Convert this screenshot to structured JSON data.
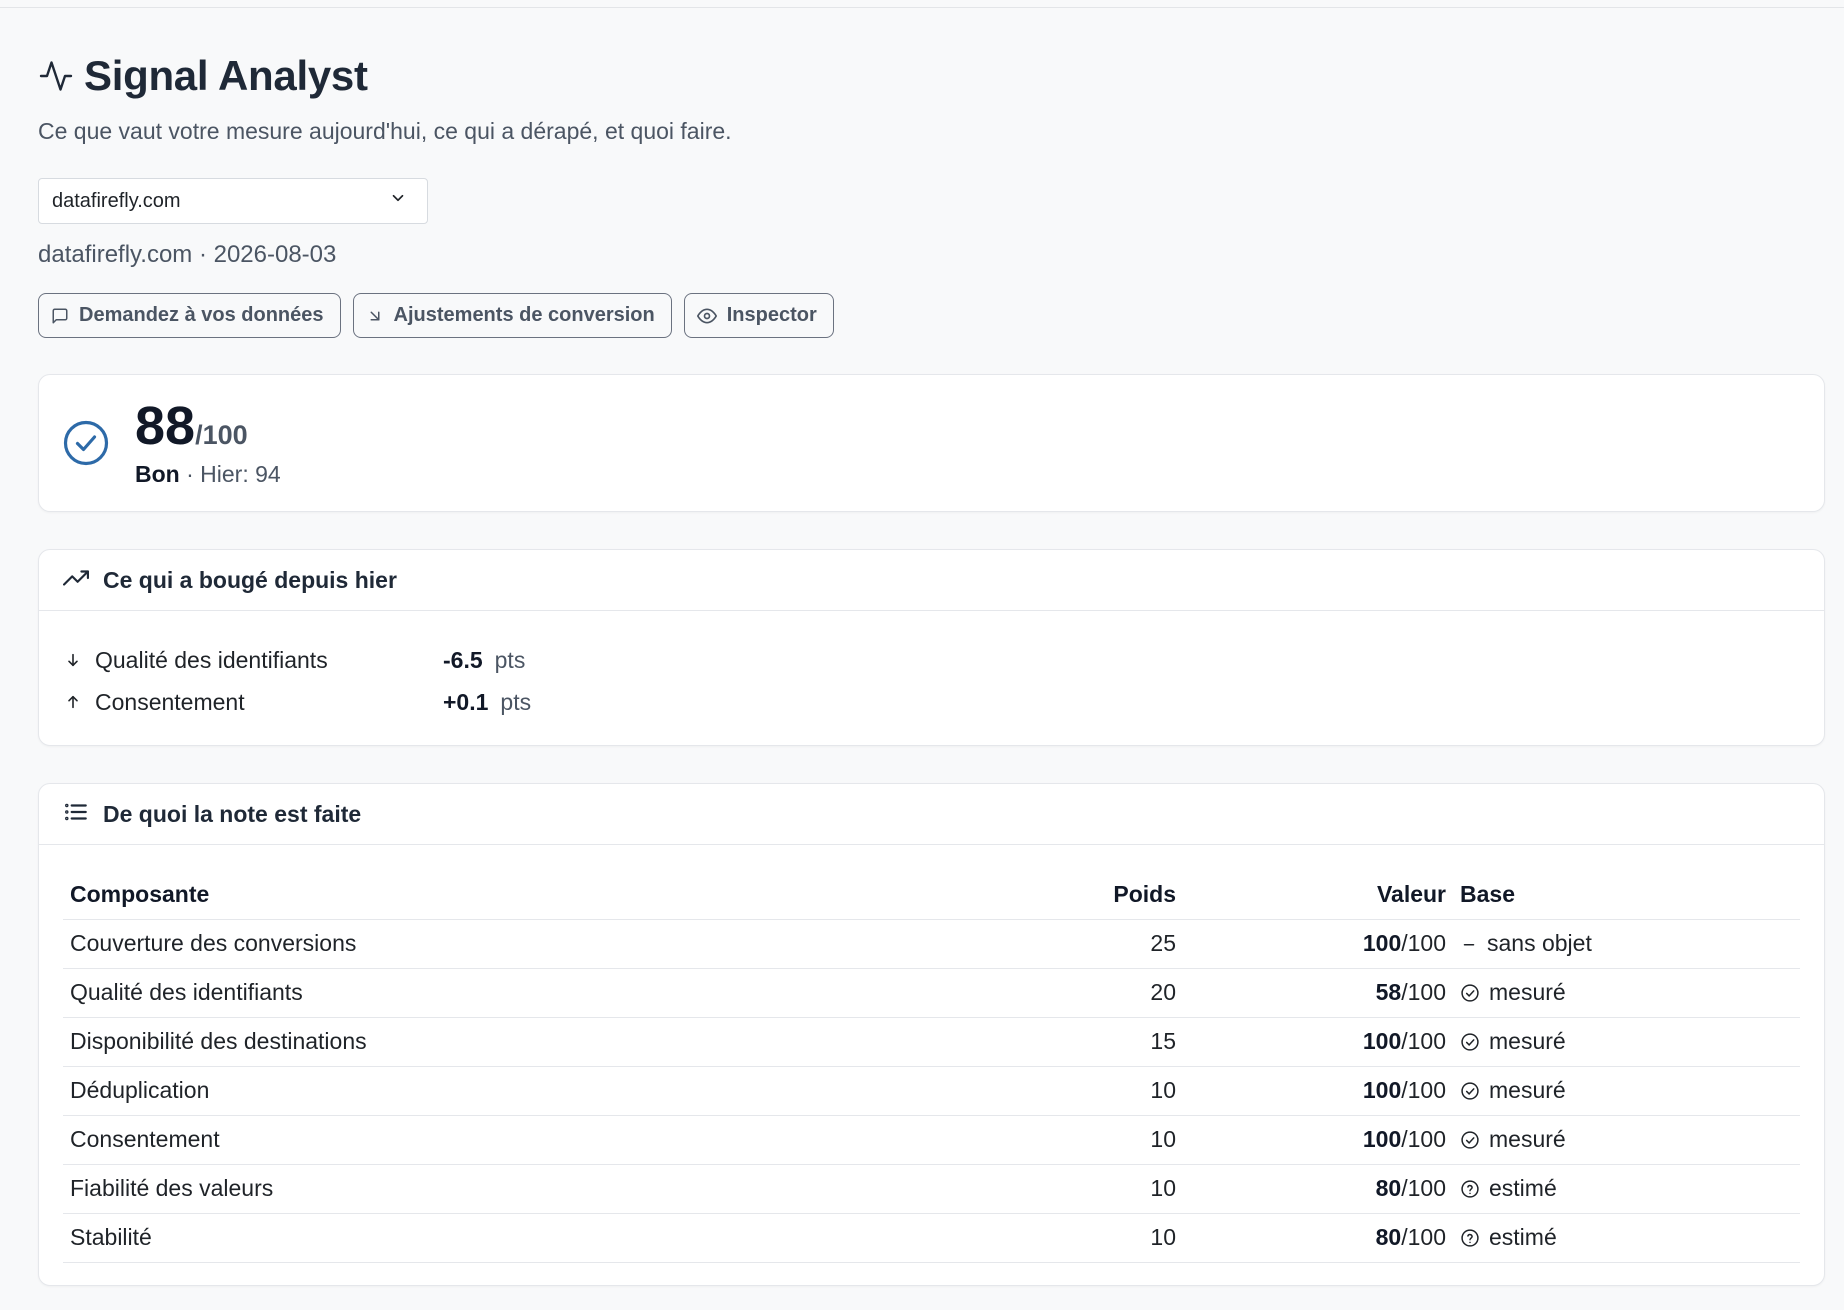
{
  "app": {
    "title": "Signal Analyst",
    "subtitle": "Ce que vaut votre mesure aujourd'hui, ce qui a dérapé, et quoi faire.",
    "title_icon": "activity-icon"
  },
  "site_select": {
    "value": "datafirefly.com"
  },
  "meta": "datafirefly.com · 2026-08-03",
  "actions": [
    {
      "label": "Demandez à vos données",
      "icon": "message-square-icon"
    },
    {
      "label": "Ajustements de conversion",
      "icon": "arrow-down-right-icon"
    },
    {
      "label": "Inspector",
      "icon": "eye-icon"
    }
  ],
  "score": {
    "value": "88",
    "max": "/100",
    "rating": "Bon",
    "yesterday": "· Hier: 94",
    "icon": "check-circle-icon",
    "color": "#2d6aa8"
  },
  "changes": {
    "title": "Ce qui a bougé depuis hier",
    "icon": "trending-up-icon",
    "items": [
      {
        "direction": "down",
        "label": "Qualité des identifiants",
        "value": "-6.5",
        "unit": "pts"
      },
      {
        "direction": "up",
        "label": "Consentement",
        "value": "+0.1",
        "unit": "pts"
      }
    ]
  },
  "breakdown": {
    "title": "De quoi la note est faite",
    "icon": "list-icon",
    "headers": {
      "component": "Composante",
      "weight": "Poids",
      "value": "Valeur",
      "base": "Base"
    },
    "rows": [
      {
        "component": "Couverture des conversions",
        "weight": "25",
        "value": "100",
        "max": "/100",
        "base": "sans objet",
        "base_icon": "dash"
      },
      {
        "component": "Qualité des identifiants",
        "weight": "20",
        "value": "58",
        "max": "/100",
        "base": "mesuré",
        "base_icon": "check"
      },
      {
        "component": "Disponibilité des destinations",
        "weight": "15",
        "value": "100",
        "max": "/100",
        "base": "mesuré",
        "base_icon": "check"
      },
      {
        "component": "Déduplication",
        "weight": "10",
        "value": "100",
        "max": "/100",
        "base": "mesuré",
        "base_icon": "check"
      },
      {
        "component": "Consentement",
        "weight": "10",
        "value": "100",
        "max": "/100",
        "base": "mesuré",
        "base_icon": "check"
      },
      {
        "component": "Fiabilité des valeurs",
        "weight": "10",
        "value": "80",
        "max": "/100",
        "base": "estimé",
        "base_icon": "question"
      },
      {
        "component": "Stabilité",
        "weight": "10",
        "value": "80",
        "max": "/100",
        "base": "estimé",
        "base_icon": "question"
      }
    ]
  }
}
